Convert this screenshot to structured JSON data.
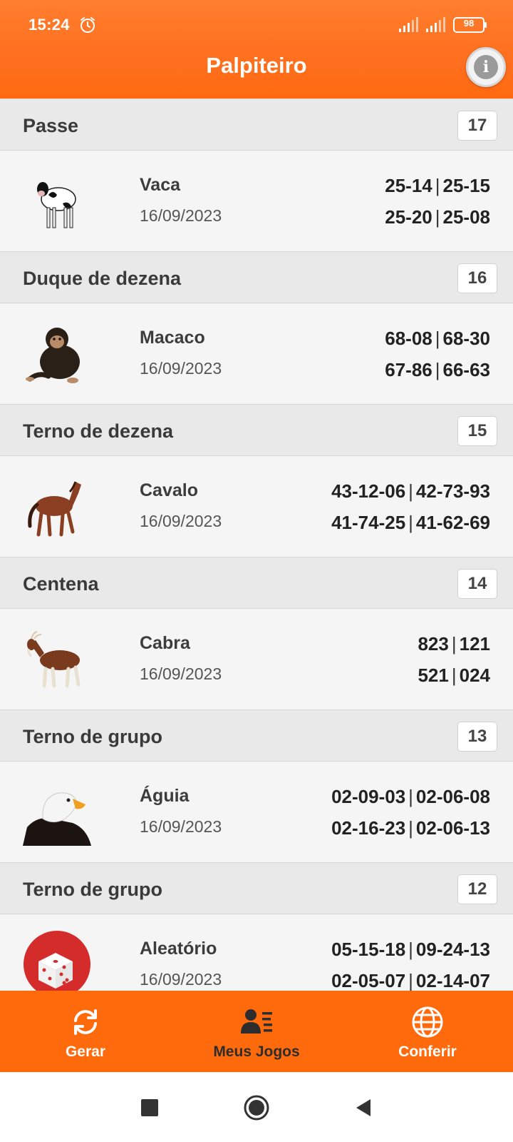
{
  "status_bar": {
    "time": "15:24",
    "battery": "98",
    "icons": [
      "alarm-icon",
      "signal-icon",
      "signal-icon",
      "battery-icon"
    ]
  },
  "app_bar": {
    "title": "Palpiteiro",
    "info_icon": "info-icon"
  },
  "sections": [
    {
      "title": "Passe",
      "count": "17",
      "animal": "Vaca",
      "image": "cow",
      "date": "16/09/2023",
      "numbers": [
        [
          "25-14",
          "25-15"
        ],
        [
          "25-20",
          "25-08"
        ]
      ]
    },
    {
      "title": "Duque de dezena",
      "count": "16",
      "animal": "Macaco",
      "image": "monkey",
      "date": "16/09/2023",
      "numbers": [
        [
          "68-08",
          "68-30"
        ],
        [
          "67-86",
          "66-63"
        ]
      ]
    },
    {
      "title": "Terno de dezena",
      "count": "15",
      "animal": "Cavalo",
      "image": "horse",
      "date": "16/09/2023",
      "numbers": [
        [
          "43-12-06",
          "42-73-93"
        ],
        [
          "41-74-25",
          "41-62-69"
        ]
      ]
    },
    {
      "title": "Centena",
      "count": "14",
      "animal": "Cabra",
      "image": "goat",
      "date": "16/09/2023",
      "numbers": [
        [
          "823",
          "121"
        ],
        [
          "521",
          "024"
        ]
      ]
    },
    {
      "title": "Terno de grupo",
      "count": "13",
      "animal": "Águia",
      "image": "eagle",
      "date": "16/09/2023",
      "numbers": [
        [
          "02-09-03",
          "02-06-08"
        ],
        [
          "02-16-23",
          "02-06-13"
        ]
      ]
    },
    {
      "title": "Terno de grupo",
      "count": "12",
      "animal": "Aleatório",
      "image": "dice",
      "date": "16/09/2023",
      "numbers": [
        [
          "05-15-18",
          "09-24-13"
        ],
        [
          "02-05-07",
          "02-14-07"
        ]
      ]
    }
  ],
  "separator": "|",
  "bottom_nav": {
    "items": [
      {
        "label": "Gerar",
        "icon": "refresh-icon",
        "selected": false
      },
      {
        "label": "Meus Jogos",
        "icon": "user-list-icon",
        "selected": true
      },
      {
        "label": "Conferir",
        "icon": "globe-icon",
        "selected": false
      }
    ]
  },
  "colors": {
    "accent": "#ff6a0d",
    "header_bg": "#e9e9e9",
    "row_bg": "#f5f5f5",
    "selected_nav": "#2d2d2d"
  }
}
